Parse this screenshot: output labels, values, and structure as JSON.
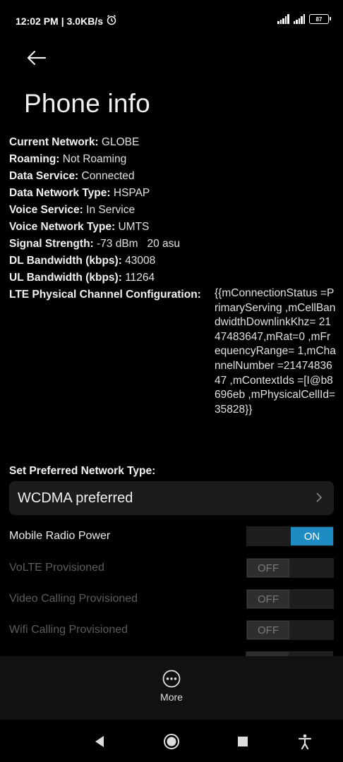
{
  "status_bar": {
    "time": "12:02 PM",
    "speed": "3.0KB/s",
    "battery": "87"
  },
  "header": {
    "title": "Phone info"
  },
  "info": [
    {
      "label": "Current Network:",
      "value": "GLOBE"
    },
    {
      "label": "Roaming:",
      "value": "Not Roaming"
    },
    {
      "label": "Data Service:",
      "value": "Connected"
    },
    {
      "label": "Data Network Type:",
      "value": "HSPAP"
    },
    {
      "label": "Voice Service:",
      "value": "In Service"
    },
    {
      "label": "Voice Network Type:",
      "value": "UMTS"
    },
    {
      "label": "Signal Strength:",
      "value": "-73 dBm   20 asu"
    },
    {
      "label": "DL Bandwidth (kbps):",
      "value": "43008"
    },
    {
      "label": "UL Bandwidth (kbps):",
      "value": "11264"
    }
  ],
  "lte": {
    "label": "LTE Physical Channel Configuration:",
    "value": "{{mConnectionStatus =PrimaryServing ,mCellBandwidthDownlinkKhz= 2147483647,mRat=0 ,mFrequencyRange= 1,mChannelNumber =2147483647 ,mContextIds =[I@b8696eb ,mPhysicalCellId= 35828}}"
  },
  "preferred_network": {
    "label": "Set Preferred Network Type:",
    "value": "WCDMA preferred"
  },
  "toggles": [
    {
      "label": "Mobile Radio Power",
      "state": "ON"
    },
    {
      "label": "VoLTE Provisioned",
      "state": "OFF"
    },
    {
      "label": "Video Calling Provisioned",
      "state": "OFF"
    },
    {
      "label": "Wifi Calling Provisioned",
      "state": "OFF"
    }
  ],
  "bottom_bar": {
    "more_label": "More"
  },
  "colors": {
    "accent": "#1e8bc3",
    "background": "#000000"
  }
}
